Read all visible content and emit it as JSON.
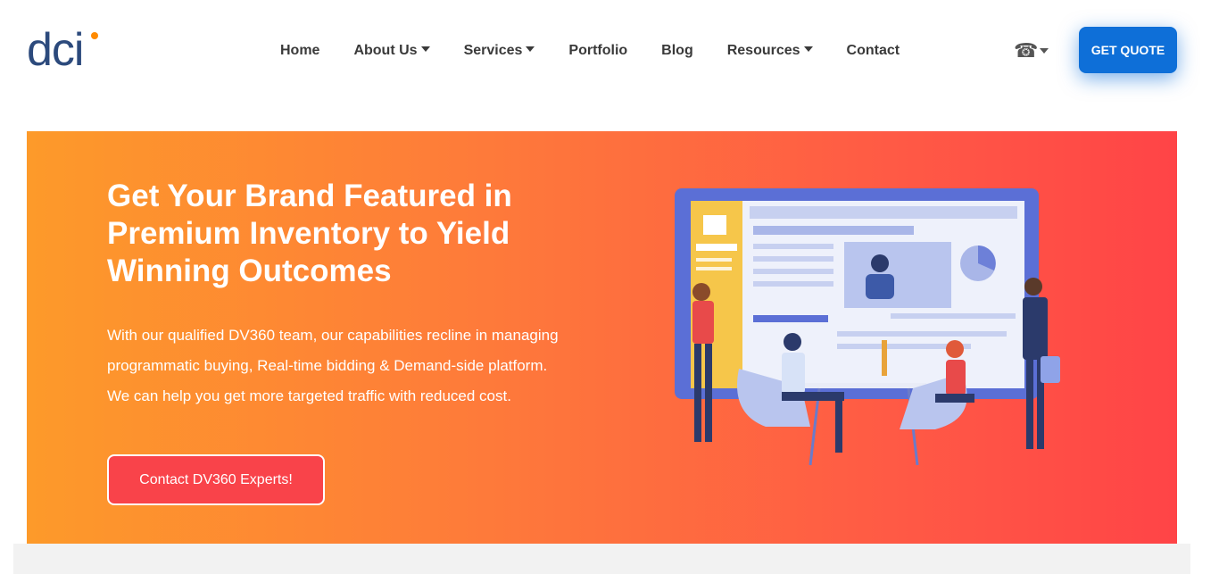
{
  "header": {
    "logo_text": "dci",
    "nav": [
      {
        "label": "Home",
        "dropdown": false
      },
      {
        "label": "About Us",
        "dropdown": true
      },
      {
        "label": "Services",
        "dropdown": true
      },
      {
        "label": "Portfolio",
        "dropdown": false
      },
      {
        "label": "Blog",
        "dropdown": false
      },
      {
        "label": "Resources",
        "dropdown": true
      },
      {
        "label": "Contact",
        "dropdown": false
      }
    ],
    "phone_icon": "phone-icon",
    "quote_label": "GET QUOTE"
  },
  "hero": {
    "title": "Get Your Brand Featured in Premium Inventory to Yield Winning Outcomes",
    "text": "With our qualified DV360 team, our capabilities recline in managing programmatic buying, Real-time bidding & Demand-side platform. We can help you get more targeted traffic with reduced cost.",
    "cta_label": "Contact DV360 Experts!"
  },
  "colors": {
    "brand": "#2c4a7c",
    "accent": "#0e6fd8",
    "hero_start": "#fd9a2a",
    "hero_end": "#ff4447",
    "cta": "#f9434a"
  }
}
